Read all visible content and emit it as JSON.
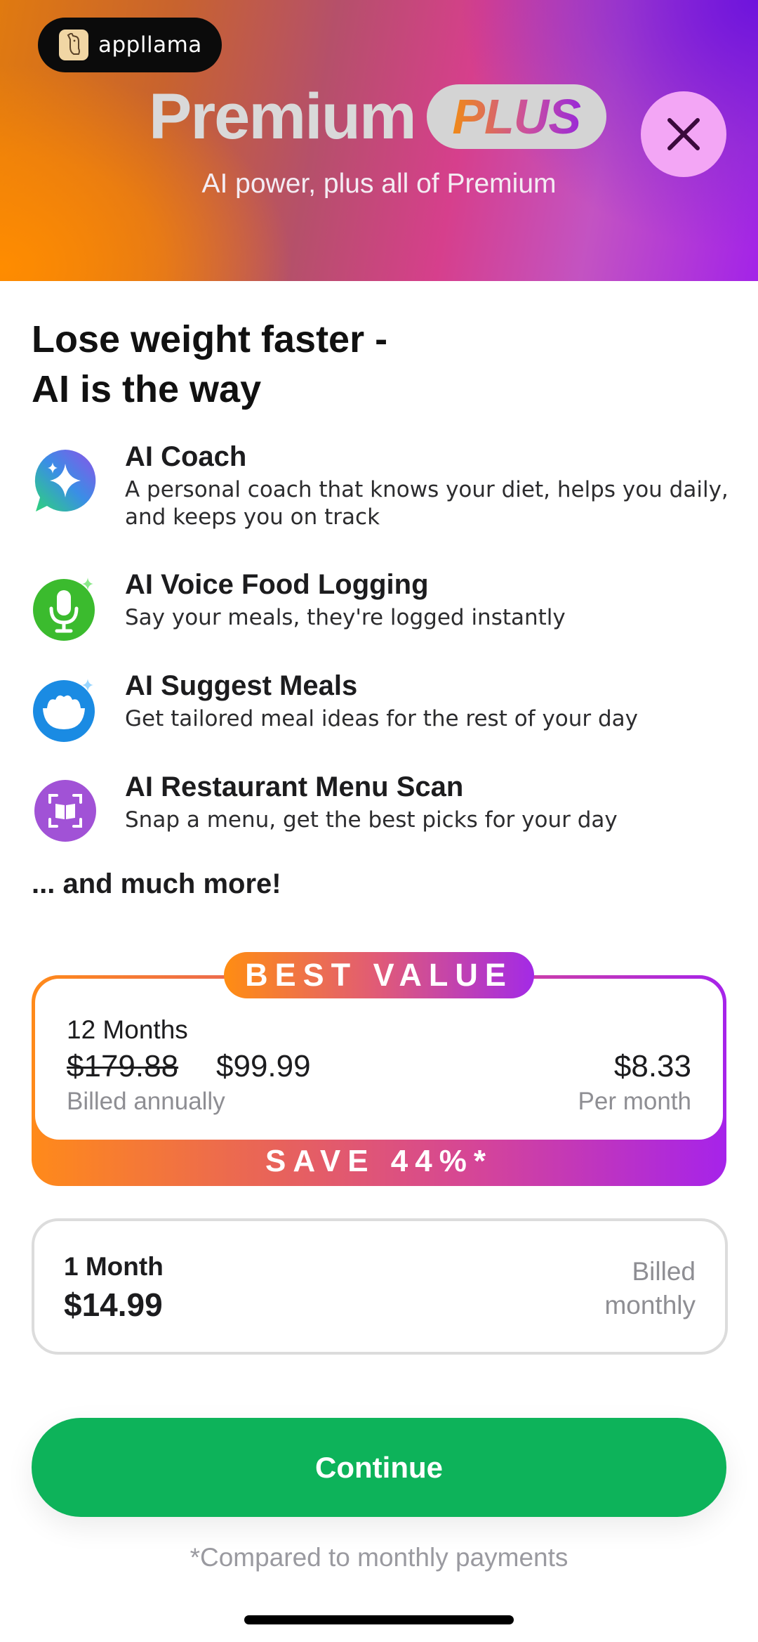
{
  "brand": {
    "name": "appllama",
    "icon": "llama-logo-icon"
  },
  "header": {
    "title": "Premium",
    "badge": "PLUS",
    "subtitle": "AI power, plus all of Premium",
    "close_icon": "close-icon",
    "colors": {
      "orange": "#ff8c00",
      "magenta": "#d63f8c",
      "purple": "#a323e8",
      "close_bg": "#f3a6f5"
    }
  },
  "headline": [
    "Lose weight faster -",
    "AI is the way"
  ],
  "features": [
    {
      "icon": "ai-coach-sparkle-icon",
      "title": "AI Coach",
      "description": "A personal coach that knows your diet, helps you daily, and keeps you on track"
    },
    {
      "icon": "microphone-icon",
      "title": "AI Voice Food Logging",
      "description": "Say your meals, they're logged instantly"
    },
    {
      "icon": "meal-bowl-icon",
      "title": "AI Suggest Meals",
      "description": "Get tailored meal ideas for the rest of your day"
    },
    {
      "icon": "menu-scan-icon",
      "title": "AI Restaurant Menu Scan",
      "description": "Snap a menu, get the best picks for your day"
    }
  ],
  "more_text": "... and much more!",
  "plans": {
    "annual": {
      "badge": "BEST VALUE",
      "duration": "12 Months",
      "original_price": "$179.88",
      "price": "$99.99",
      "billing": "Billed annually",
      "monthly_equivalent": "$8.33",
      "per_label": "Per month",
      "savings": "SAVE 44%*",
      "selected": true
    },
    "monthly": {
      "duration": "1 Month",
      "price": "$14.99",
      "billing_line1": "Billed",
      "billing_line2": "monthly",
      "selected": false
    }
  },
  "continue_label": "Continue",
  "continue_color": "#0db35a",
  "footnote": "*Compared to monthly payments"
}
